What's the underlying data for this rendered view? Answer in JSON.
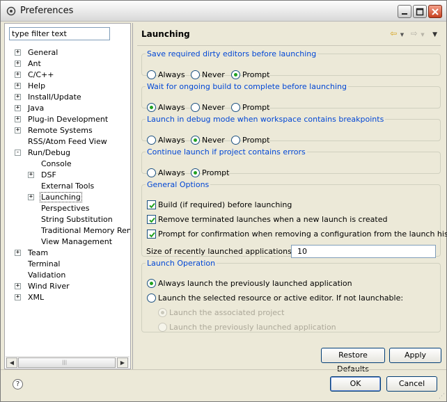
{
  "window": {
    "title": "Preferences"
  },
  "filter": {
    "placeholder": "type filter text"
  },
  "tree": {
    "items": [
      {
        "label": "General",
        "level": 0,
        "expander": "+"
      },
      {
        "label": "Ant",
        "level": 0,
        "expander": "+"
      },
      {
        "label": "C/C++",
        "level": 0,
        "expander": "+"
      },
      {
        "label": "Help",
        "level": 0,
        "expander": "+"
      },
      {
        "label": "Install/Update",
        "level": 0,
        "expander": "+"
      },
      {
        "label": "Java",
        "level": 0,
        "expander": "+"
      },
      {
        "label": "Plug-in Development",
        "level": 0,
        "expander": "+"
      },
      {
        "label": "Remote Systems",
        "level": 0,
        "expander": "+"
      },
      {
        "label": "RSS/Atom Feed View",
        "level": 0,
        "expander": ""
      },
      {
        "label": "Run/Debug",
        "level": 0,
        "expander": "-"
      },
      {
        "label": "Console",
        "level": 1,
        "expander": ""
      },
      {
        "label": "DSF",
        "level": 1,
        "expander": "+"
      },
      {
        "label": "External Tools",
        "level": 1,
        "expander": ""
      },
      {
        "label": "Launching",
        "level": 1,
        "expander": "+",
        "selected": true
      },
      {
        "label": "Perspectives",
        "level": 1,
        "expander": ""
      },
      {
        "label": "String Substitution",
        "level": 1,
        "expander": ""
      },
      {
        "label": "Traditional Memory Renderi",
        "level": 1,
        "expander": ""
      },
      {
        "label": "View Management",
        "level": 1,
        "expander": ""
      },
      {
        "label": "Team",
        "level": 0,
        "expander": "+"
      },
      {
        "label": "Terminal",
        "level": 0,
        "expander": ""
      },
      {
        "label": "Validation",
        "level": 0,
        "expander": ""
      },
      {
        "label": "Wind River",
        "level": 0,
        "expander": "+"
      },
      {
        "label": "XML",
        "level": 0,
        "expander": "+"
      }
    ]
  },
  "page": {
    "title": "Launching"
  },
  "groups": {
    "save_dirty": {
      "legend": "Save required dirty editors before launching",
      "always": "Always",
      "never": "Never",
      "prompt": "Prompt",
      "selected": "prompt"
    },
    "wait_build": {
      "legend": "Wait for ongoing build to complete before launching",
      "always": "Always",
      "never": "Never",
      "prompt": "Prompt",
      "selected": "always"
    },
    "debug_mode": {
      "legend": "Launch in debug mode when workspace contains breakpoints",
      "always": "Always",
      "never": "Never",
      "prompt": "Prompt",
      "selected": "never"
    },
    "continue_errors": {
      "legend": "Continue launch if project contains errors",
      "always": "Always",
      "prompt": "Prompt",
      "selected": "prompt"
    },
    "general": {
      "legend": "General Options",
      "build_label": "Build (if required) before launching",
      "remove_label": "Remove terminated launches when a new launch is created",
      "confirm_label": "Prompt for confirmation when removing a configuration from the launch history",
      "size_label": "Size of recently launched applications list:",
      "size_value": "10"
    },
    "launch_op": {
      "legend": "Launch Operation",
      "previous_label": "Always launch the previously launched application",
      "selected_label": "Launch the selected resource or active editor. If not launchable:",
      "associated_label": "Launch the associated project",
      "previous_sub_label": "Launch the previously launched application"
    }
  },
  "buttons": {
    "restore": "Restore Defaults",
    "apply": "Apply",
    "ok": "OK",
    "cancel": "Cancel"
  },
  "icons": {
    "help": "?",
    "back": "⇦",
    "forward": "⇨",
    "menu": "▼",
    "scroll_left": "◀",
    "scroll_right": "▶",
    "thumb_grip": "|||"
  }
}
